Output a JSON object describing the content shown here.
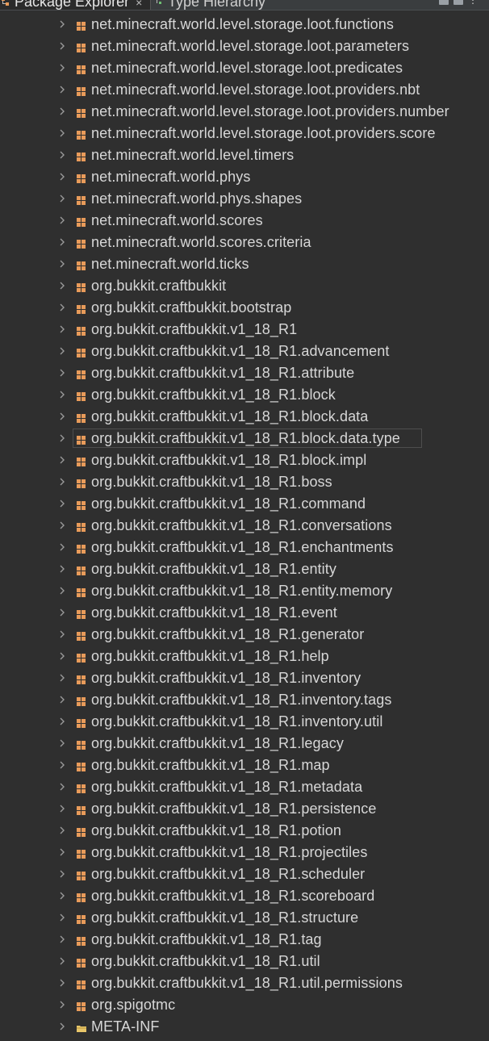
{
  "tabs": [
    {
      "label": "Package Explorer",
      "icon": "package-explorer-icon",
      "active": true
    },
    {
      "label": "Type Hierarchy",
      "icon": "type-hierarchy-icon",
      "active": false
    }
  ],
  "colors": {
    "background": "#2f2f2f",
    "text": "#d7d7d7",
    "package_icon": "#e89b5a",
    "folder_icon": "#e8c66a"
  },
  "tree": {
    "selected_index": 19,
    "items": [
      {
        "label": "net.minecraft.world.level.storage.loot.functions",
        "icon": "package-icon"
      },
      {
        "label": "net.minecraft.world.level.storage.loot.parameters",
        "icon": "package-icon"
      },
      {
        "label": "net.minecraft.world.level.storage.loot.predicates",
        "icon": "package-icon"
      },
      {
        "label": "net.minecraft.world.level.storage.loot.providers.nbt",
        "icon": "package-icon"
      },
      {
        "label": "net.minecraft.world.level.storage.loot.providers.number",
        "icon": "package-icon"
      },
      {
        "label": "net.minecraft.world.level.storage.loot.providers.score",
        "icon": "package-icon"
      },
      {
        "label": "net.minecraft.world.level.timers",
        "icon": "package-icon"
      },
      {
        "label": "net.minecraft.world.phys",
        "icon": "package-icon"
      },
      {
        "label": "net.minecraft.world.phys.shapes",
        "icon": "package-icon"
      },
      {
        "label": "net.minecraft.world.scores",
        "icon": "package-icon"
      },
      {
        "label": "net.minecraft.world.scores.criteria",
        "icon": "package-icon"
      },
      {
        "label": "net.minecraft.world.ticks",
        "icon": "package-icon"
      },
      {
        "label": "org.bukkit.craftbukkit",
        "icon": "package-icon"
      },
      {
        "label": "org.bukkit.craftbukkit.bootstrap",
        "icon": "package-icon"
      },
      {
        "label": "org.bukkit.craftbukkit.v1_18_R1",
        "icon": "package-icon"
      },
      {
        "label": "org.bukkit.craftbukkit.v1_18_R1.advancement",
        "icon": "package-icon"
      },
      {
        "label": "org.bukkit.craftbukkit.v1_18_R1.attribute",
        "icon": "package-icon"
      },
      {
        "label": "org.bukkit.craftbukkit.v1_18_R1.block",
        "icon": "package-icon"
      },
      {
        "label": "org.bukkit.craftbukkit.v1_18_R1.block.data",
        "icon": "package-icon"
      },
      {
        "label": "org.bukkit.craftbukkit.v1_18_R1.block.data.type",
        "icon": "package-icon"
      },
      {
        "label": "org.bukkit.craftbukkit.v1_18_R1.block.impl",
        "icon": "package-icon"
      },
      {
        "label": "org.bukkit.craftbukkit.v1_18_R1.boss",
        "icon": "package-icon"
      },
      {
        "label": "org.bukkit.craftbukkit.v1_18_R1.command",
        "icon": "package-icon"
      },
      {
        "label": "org.bukkit.craftbukkit.v1_18_R1.conversations",
        "icon": "package-icon"
      },
      {
        "label": "org.bukkit.craftbukkit.v1_18_R1.enchantments",
        "icon": "package-icon"
      },
      {
        "label": "org.bukkit.craftbukkit.v1_18_R1.entity",
        "icon": "package-icon"
      },
      {
        "label": "org.bukkit.craftbukkit.v1_18_R1.entity.memory",
        "icon": "package-icon"
      },
      {
        "label": "org.bukkit.craftbukkit.v1_18_R1.event",
        "icon": "package-icon"
      },
      {
        "label": "org.bukkit.craftbukkit.v1_18_R1.generator",
        "icon": "package-icon"
      },
      {
        "label": "org.bukkit.craftbukkit.v1_18_R1.help",
        "icon": "package-icon"
      },
      {
        "label": "org.bukkit.craftbukkit.v1_18_R1.inventory",
        "icon": "package-icon"
      },
      {
        "label": "org.bukkit.craftbukkit.v1_18_R1.inventory.tags",
        "icon": "package-icon"
      },
      {
        "label": "org.bukkit.craftbukkit.v1_18_R1.inventory.util",
        "icon": "package-icon"
      },
      {
        "label": "org.bukkit.craftbukkit.v1_18_R1.legacy",
        "icon": "package-icon"
      },
      {
        "label": "org.bukkit.craftbukkit.v1_18_R1.map",
        "icon": "package-icon"
      },
      {
        "label": "org.bukkit.craftbukkit.v1_18_R1.metadata",
        "icon": "package-icon"
      },
      {
        "label": "org.bukkit.craftbukkit.v1_18_R1.persistence",
        "icon": "package-icon"
      },
      {
        "label": "org.bukkit.craftbukkit.v1_18_R1.potion",
        "icon": "package-icon"
      },
      {
        "label": "org.bukkit.craftbukkit.v1_18_R1.projectiles",
        "icon": "package-icon"
      },
      {
        "label": "org.bukkit.craftbukkit.v1_18_R1.scheduler",
        "icon": "package-icon"
      },
      {
        "label": "org.bukkit.craftbukkit.v1_18_R1.scoreboard",
        "icon": "package-icon"
      },
      {
        "label": "org.bukkit.craftbukkit.v1_18_R1.structure",
        "icon": "package-icon"
      },
      {
        "label": "org.bukkit.craftbukkit.v1_18_R1.tag",
        "icon": "package-icon"
      },
      {
        "label": "org.bukkit.craftbukkit.v1_18_R1.util",
        "icon": "package-icon"
      },
      {
        "label": "org.bukkit.craftbukkit.v1_18_R1.util.permissions",
        "icon": "package-icon"
      },
      {
        "label": "org.spigotmc",
        "icon": "package-icon"
      },
      {
        "label": "META-INF",
        "icon": "folder-icon"
      }
    ]
  }
}
